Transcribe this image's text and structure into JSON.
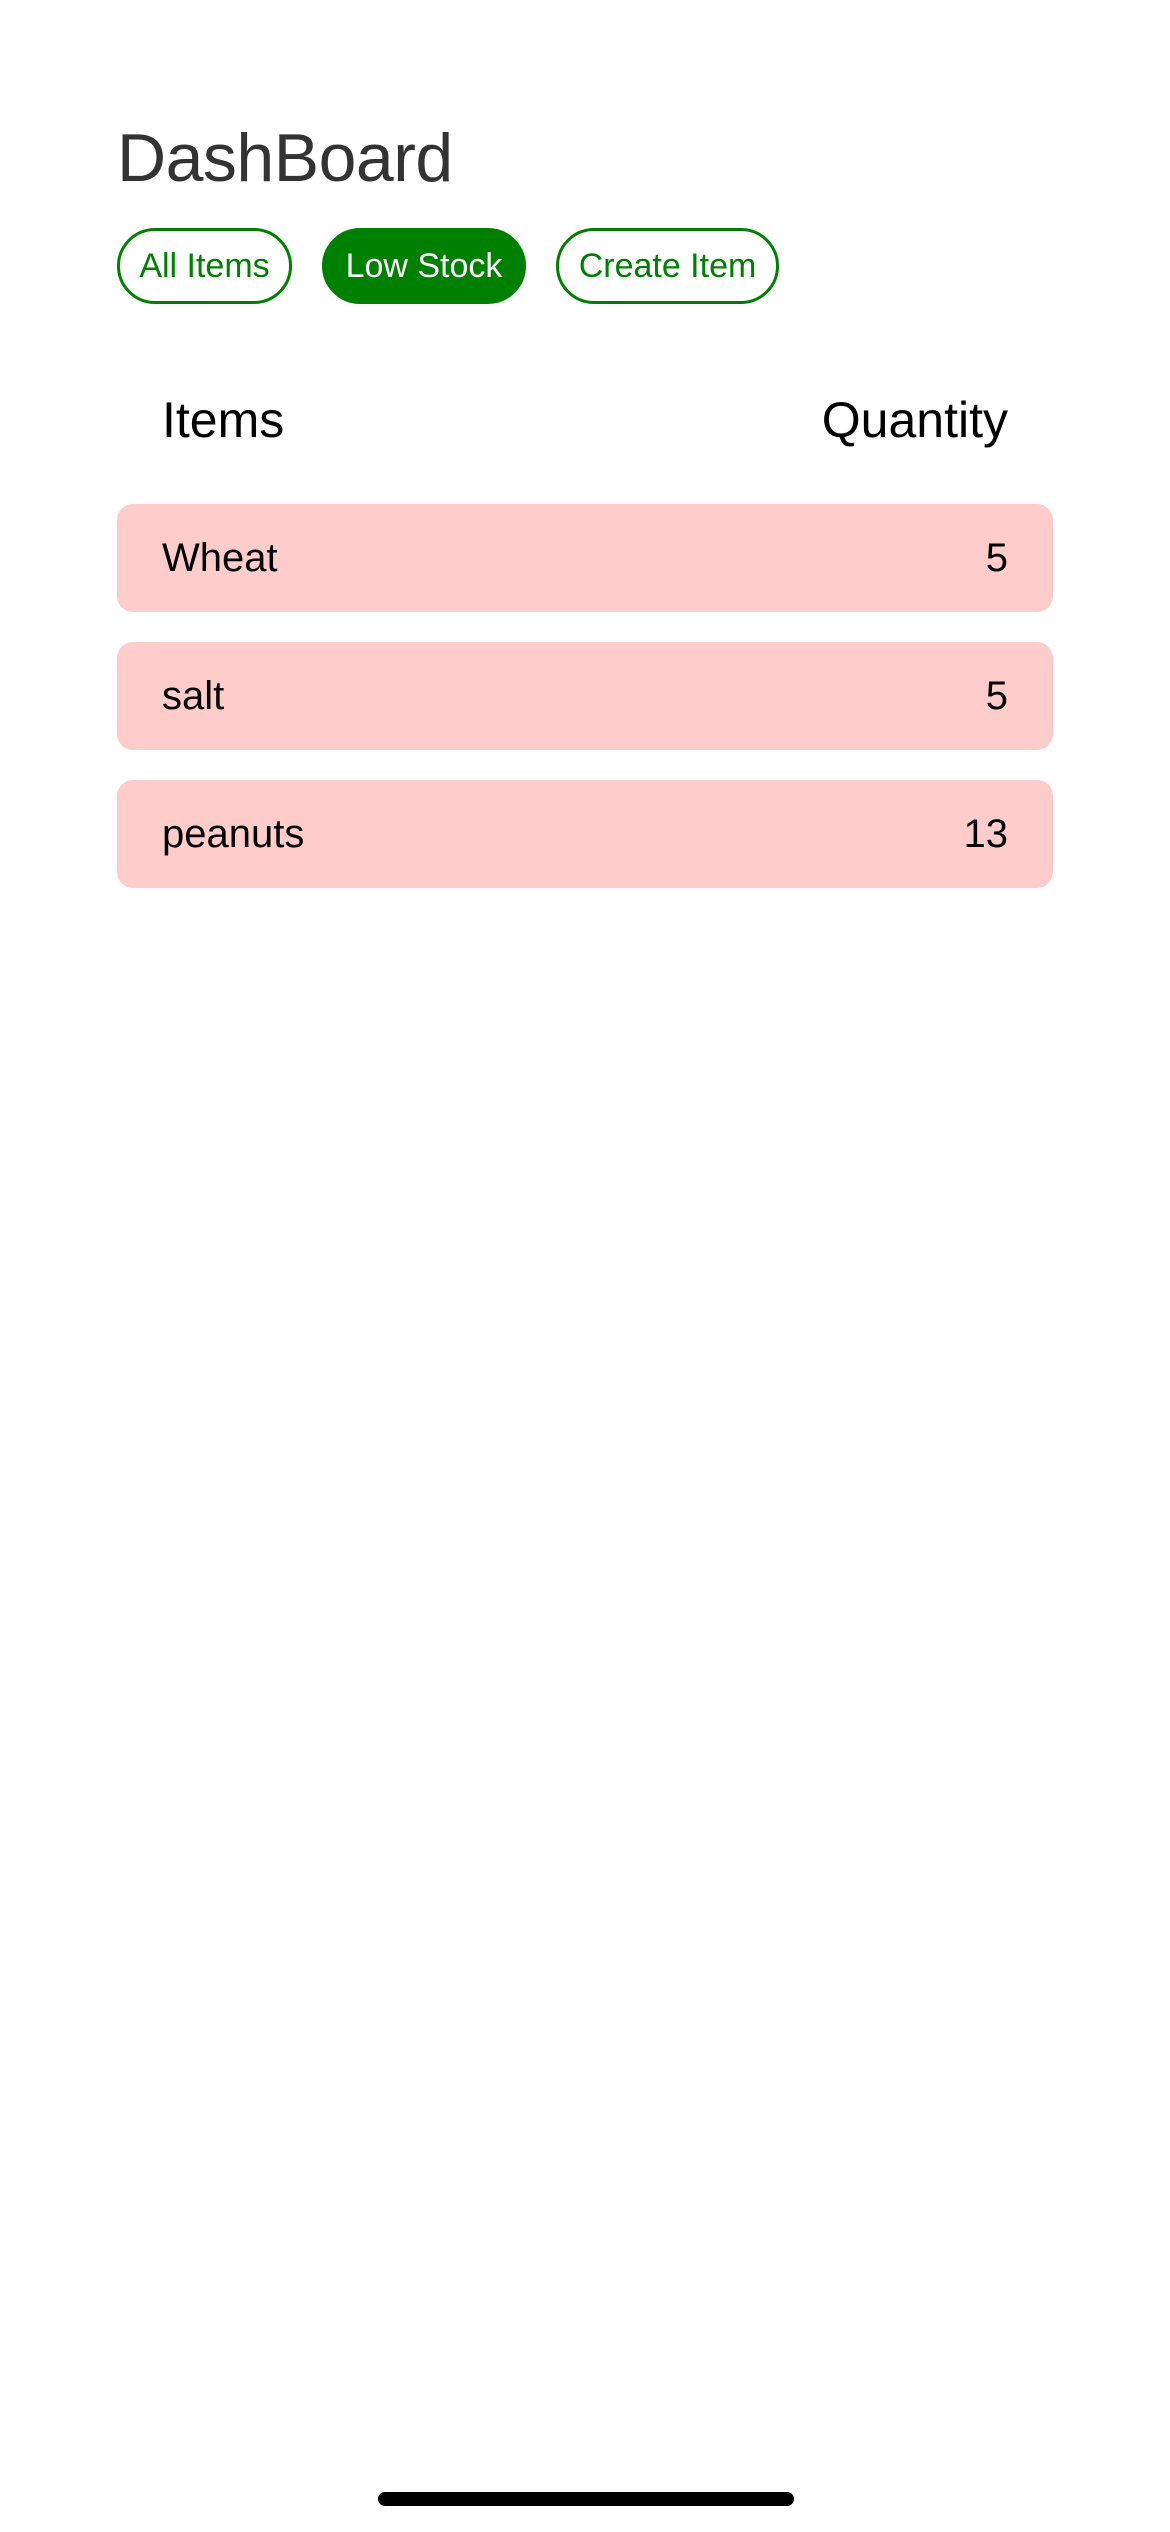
{
  "header": {
    "title": "DashBoard"
  },
  "tabs": [
    {
      "label": "All Items",
      "active": false
    },
    {
      "label": "Low Stock",
      "active": true
    },
    {
      "label": "Create Item",
      "active": false
    }
  ],
  "table": {
    "columns": [
      "Items",
      "Quantity"
    ],
    "rows": [
      {
        "name": "Wheat",
        "quantity": "5"
      },
      {
        "name": "salt",
        "quantity": "5"
      },
      {
        "name": "peanuts",
        "quantity": "13"
      }
    ]
  },
  "colors": {
    "accent": "#008000",
    "row_background": "#ffcccc",
    "title_text": "#333333"
  }
}
